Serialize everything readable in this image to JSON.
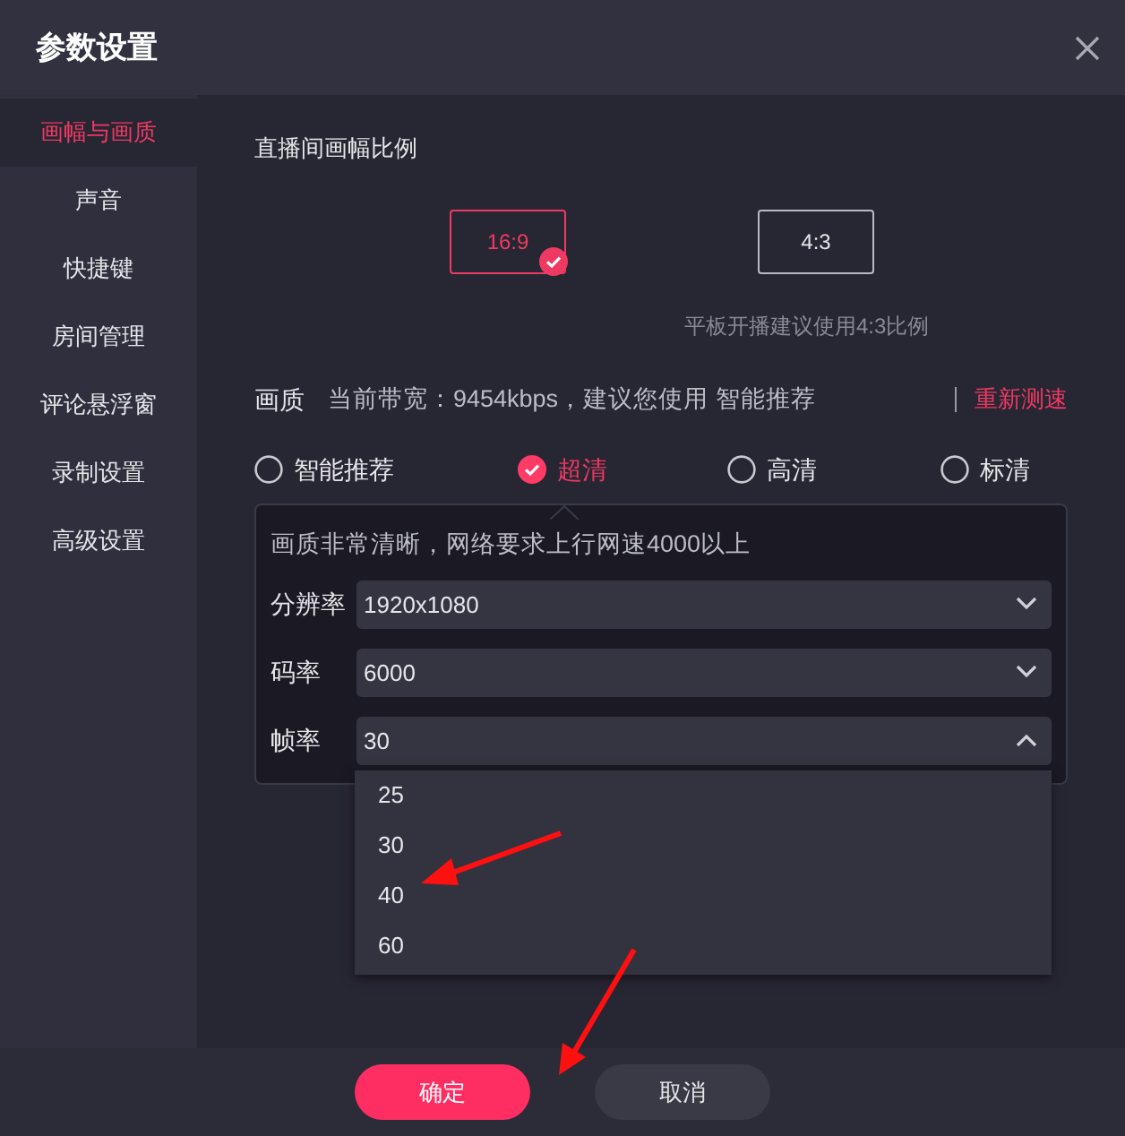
{
  "window": {
    "title": "参数设置"
  },
  "sidebar": {
    "items": [
      {
        "label": "画幅与画质",
        "selected": true
      },
      {
        "label": "声音",
        "selected": false
      },
      {
        "label": "快捷键",
        "selected": false
      },
      {
        "label": "房间管理",
        "selected": false
      },
      {
        "label": "评论悬浮窗",
        "selected": false
      },
      {
        "label": "录制设置",
        "selected": false
      },
      {
        "label": "高级设置",
        "selected": false
      }
    ]
  },
  "aspect": {
    "title": "直播间画幅比例",
    "options": [
      {
        "label": "16:9",
        "selected": true
      },
      {
        "label": "4:3",
        "selected": false
      }
    ],
    "hint": "平板开播建议使用4:3比例"
  },
  "quality": {
    "label": "画质",
    "bandwidth_text": "当前带宽：9454kbps，建议您使用 智能推荐",
    "retest": "重新测速",
    "options": [
      {
        "label": "智能推荐",
        "selected": false
      },
      {
        "label": "超清",
        "selected": true
      },
      {
        "label": "高清",
        "selected": false
      },
      {
        "label": "标清",
        "selected": false
      }
    ],
    "description": "画质非常清晰，网络要求上行网速4000以上",
    "fields": [
      {
        "label": "分辨率",
        "value": "1920x1080",
        "expanded": false
      },
      {
        "label": "码率",
        "value": "6000",
        "expanded": false
      },
      {
        "label": "帧率",
        "value": "30",
        "expanded": true
      }
    ],
    "dropdown": [
      "25",
      "30",
      "40",
      "60"
    ]
  },
  "buttons": [
    {
      "label": "确定",
      "kind": "primary"
    },
    {
      "label": "取消",
      "kind": "secondary"
    }
  ]
}
